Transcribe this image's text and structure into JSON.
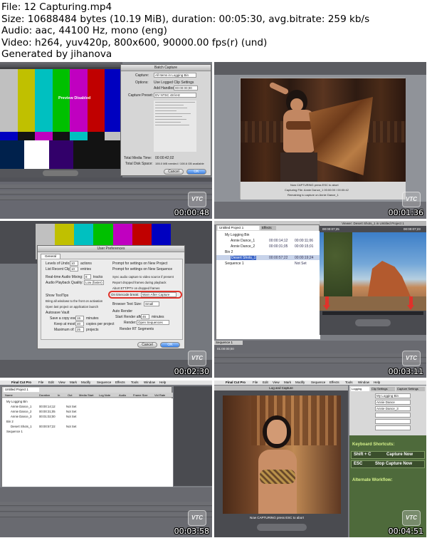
{
  "header": {
    "lines": [
      "File: 12 Capturing.mp4",
      "Size: 10688484 bytes (10.19 MiB), duration: 00:05:30, avg.bitrate: 259 kb/s",
      "Audio: aac, 44100 Hz, mono (eng)",
      "Video: h264, yuv420p, 800x600, 90000.00 fps(r) (und)",
      "Generated by jihanova"
    ]
  },
  "watermark": "VTC",
  "thumbnails": [
    {
      "timestamp": "00:00:48",
      "dialog_title": "Batch Capture",
      "preview_label": "Preview Disabled",
      "capture_label": "Capture:",
      "capture_value": "All Items in Logging Bin",
      "options_label": "Options:",
      "option_1": "Use Logged Clip Settings",
      "option_2": "Add Handles:",
      "handles_value": "00:00:00;00",
      "preset_label": "Capture Preset:",
      "preset_value": "DV NTSC 48 kHz",
      "total_media_label": "Total Media Time:",
      "total_media_value": "00:00:42;02",
      "total_disk_label": "Total Disk Space:",
      "total_disk_value": "155.0 MB needed / 108.6 GB available",
      "cancel": "Cancel",
      "ok": "OK"
    },
    {
      "timestamp": "00:01:36",
      "capture_text_1": "Now CAPTURING press ESC to abort",
      "capture_text_2": "Capturing File: Annie Dance_1 00:00:00 / 00:00:42",
      "capture_text_3": "Remaining to capture on Annie Dance_1"
    },
    {
      "timestamp": "00:02:30",
      "dialog_title": "User Preferences",
      "tab_general": "General",
      "levels_undo_label": "Levels of Undo:",
      "levels_undo_value": "10",
      "levels_undo_unit": "actions",
      "recent_clips_label": "List Recent Clips:",
      "recent_clips_value": "10",
      "recent_clips_unit": "entries",
      "mixing_label": "Real-time Audio Mixing:",
      "mixing_value": "8",
      "mixing_unit": "tracks",
      "playback_label": "Audio Playback Quality:",
      "playback_value": "Low (faster)",
      "prompt_project": "Prompt for settings on New Project",
      "prompt_sequence": "Prompt for settings on New Sequence",
      "sync_audio": "Sync audio capture to video source if present",
      "report_frames": "Report dropped frames during playback",
      "abort_etc": "Abort ETT/PTV on dropped frames",
      "on_timecode_label": "On timecode break:",
      "on_timecode_value": "Warn After Capture",
      "browser_text_label": "Browser Text Size:",
      "browser_text_value": "Small",
      "show_tooltips": "Show ToolTips",
      "bring_windows": "Bring all windows to the front on activation",
      "open_last": "Open last project on application launch",
      "autosave": "Autosave Vault",
      "save_copy_label": "Save a copy every:",
      "save_copy_value": "15",
      "save_copy_unit": "minutes",
      "keep_label": "Keep at most:",
      "keep_value": "40",
      "keep_unit": "copies per project",
      "max_label": "Maximum of:",
      "max_value": "25",
      "max_unit": "projects",
      "auto_render": "Auto Render",
      "start_render_label": "Start Render after:",
      "start_render_value": "45",
      "start_render_unit": "minutes",
      "render_label": "Render:",
      "render_value": "Open Sequences",
      "render_rt": "Render RT Segments",
      "cancel": "Cancel",
      "ok": "OK"
    },
    {
      "timestamp": "00:03:11",
      "tab_project": "Untitled Project 1",
      "tab_effects": "Effects",
      "viewer_title": "Viewer: Desert Shots_1 in Untitled Project 1",
      "bin_my_logging": "My Logging Bin",
      "clip_1": "Annie Dance_1",
      "clip_1_time": "00:00:14;12",
      "clip_1_dur": "00:00:11;06",
      "clip_2": "Annie Dance_2",
      "clip_2_time": "00:00:31;05",
      "clip_2_dur": "00:00:15;01",
      "bin_2": "Bin 2",
      "clip_3": "Desert Shots_1",
      "clip_3_time": "00:00:57;22",
      "clip_3_dur": "00:00:19;24",
      "sequence": "Sequence 1",
      "not_set": "Not Set",
      "viewer_tc_left": "00:00:07;25",
      "viewer_tc_right": "00:00:07;23",
      "seq_tab": "Sequence 1",
      "seq_tc": "01:00:00;00"
    },
    {
      "timestamp": "00:03:58",
      "menu_app": "Final Cut Pro",
      "menu": [
        "File",
        "Edit",
        "View",
        "Mark",
        "Modify",
        "Sequence",
        "Effects",
        "Tools",
        "Window",
        "Help"
      ],
      "tab_project": "Untitled Project 1",
      "columns": [
        "Name",
        "Duration",
        "In",
        "Out",
        "Media Start",
        "Log Note",
        "Audio",
        "Frame Size",
        "Vid Rate"
      ],
      "rows": [
        {
          "name": "My Logging Bin",
          "dur": "",
          "in": "",
          "out": ""
        },
        {
          "name": "Annie Dance_1",
          "dur": "00:00:14;12",
          "in": "00:00:14;12",
          "out": "Not Set"
        },
        {
          "name": "Annie Dance_2",
          "dur": "00:00:31;05",
          "in": "00:00:31;05",
          "out": "Not Set"
        },
        {
          "name": "Annie Dance_3",
          "dur": "00:01:02;00",
          "in": "00:01:02;00",
          "out": "Not Set"
        },
        {
          "name": "Bin 2",
          "dur": "",
          "in": "",
          "out": ""
        },
        {
          "name": "Desert Shots_1",
          "dur": "00:00:57;22",
          "in": "00:00:57;22",
          "out": "Not Set"
        },
        {
          "name": "Sequence 1",
          "dur": "",
          "in": "",
          "out": ""
        }
      ]
    },
    {
      "timestamp": "00:04:51",
      "menu_app": "Final Cut Pro",
      "menu": [
        "File",
        "Edit",
        "View",
        "Mark",
        "Modify",
        "Sequence",
        "Effects",
        "Tools",
        "Window",
        "Help"
      ],
      "log_title": "Log and Capture",
      "tab_logging": "Logging",
      "tab_clip": "Clip Settings",
      "tab_capture": "Capture Settings",
      "log_bin_value": "My Logging Bin",
      "reel_value": "Annie Dance",
      "name_value": "Annie Dance_3",
      "capture_text": "Now CAPTURING press ESC to abort",
      "shortcuts_title": "Keyboard Shortcuts:",
      "shortcut_1_key": "Shift + C",
      "shortcut_1_action": "Capture Now",
      "shortcut_2_key": "ESC",
      "shortcut_2_action": "Stop Capture Now",
      "alt_title": "Alternate Workflow:"
    }
  ],
  "colors": {
    "fcp_dark": "#3d3e42",
    "highlight_red": "#e0322a",
    "green_overlay": "#4e6a3b"
  }
}
